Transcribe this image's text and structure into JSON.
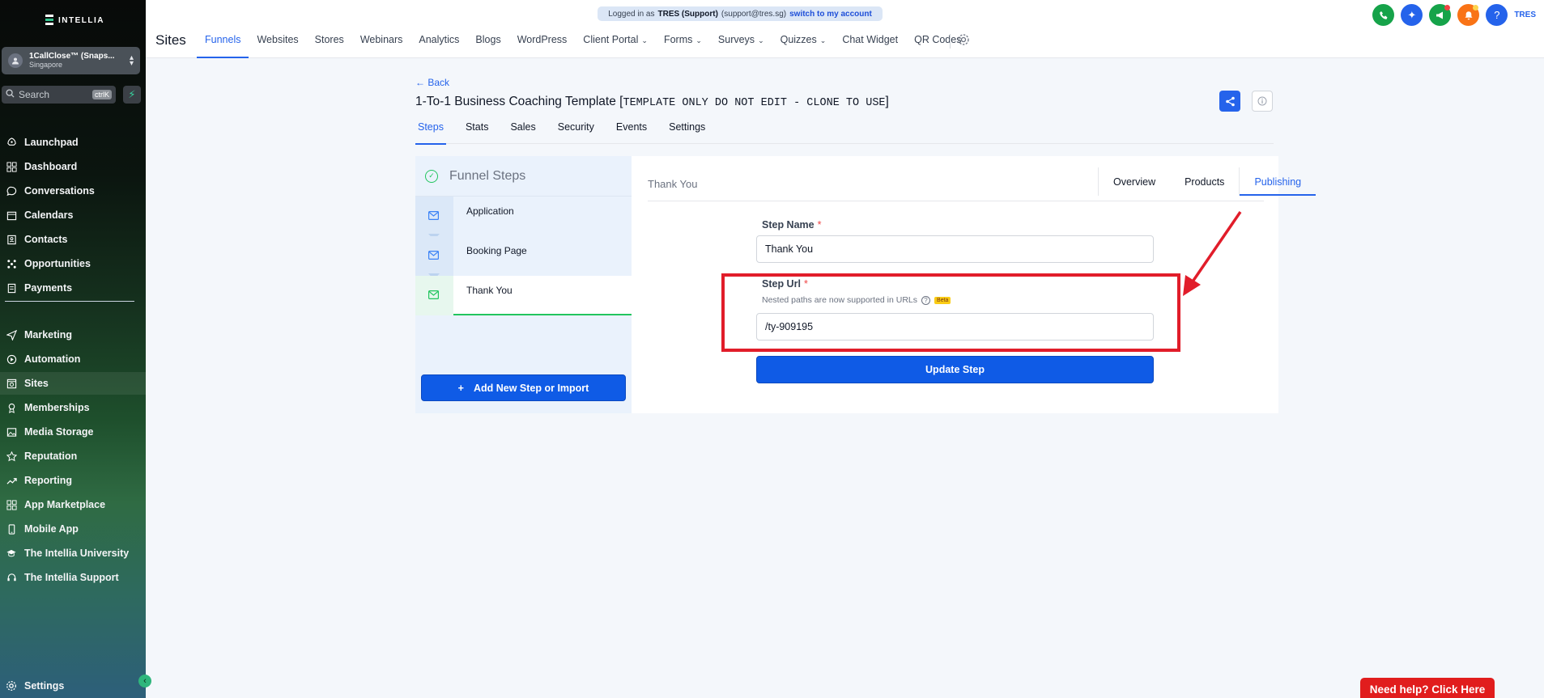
{
  "brand": {
    "name": "INTELLIA"
  },
  "account": {
    "name": "1CallClose™ (Snaps...",
    "location": "Singapore"
  },
  "search": {
    "placeholder": "Search",
    "shortcut": "ctrlK"
  },
  "sidebar": {
    "items": [
      {
        "label": "Launchpad",
        "icon": "rocket-icon"
      },
      {
        "label": "Dashboard",
        "icon": "grid-icon"
      },
      {
        "label": "Conversations",
        "icon": "chat-icon"
      },
      {
        "label": "Calendars",
        "icon": "calendar-icon"
      },
      {
        "label": "Contacts",
        "icon": "contacts-icon"
      },
      {
        "label": "Opportunities",
        "icon": "opportunities-icon"
      },
      {
        "label": "Payments",
        "icon": "payments-icon"
      },
      {
        "label": "Marketing",
        "icon": "send-icon"
      },
      {
        "label": "Automation",
        "icon": "automation-icon"
      },
      {
        "label": "Sites",
        "icon": "sites-icon",
        "active": true
      },
      {
        "label": "Memberships",
        "icon": "memberships-icon"
      },
      {
        "label": "Media Storage",
        "icon": "image-icon"
      },
      {
        "label": "Reputation",
        "icon": "star-icon"
      },
      {
        "label": "Reporting",
        "icon": "trend-icon"
      },
      {
        "label": "App Marketplace",
        "icon": "apps-icon"
      },
      {
        "label": "Mobile App",
        "icon": "mobile-icon"
      },
      {
        "label": "The Intellia University",
        "icon": "graduation-icon"
      },
      {
        "label": "The Intellia Support",
        "icon": "support-icon"
      }
    ],
    "settings_label": "Settings"
  },
  "banner": {
    "prefix": "Logged in as",
    "user": "TRES (Support)",
    "email": "(support@tres.sg)",
    "link": "switch to my account"
  },
  "header": {
    "title": "Sites",
    "tabs": [
      {
        "label": "Funnels",
        "active": true
      },
      {
        "label": "Websites"
      },
      {
        "label": "Stores"
      },
      {
        "label": "Webinars"
      },
      {
        "label": "Analytics"
      },
      {
        "label": "Blogs"
      },
      {
        "label": "WordPress"
      },
      {
        "label": "Client Portal",
        "dropdown": true
      },
      {
        "label": "Forms",
        "dropdown": true
      },
      {
        "label": "Surveys",
        "dropdown": true
      },
      {
        "label": "Quizzes",
        "dropdown": true
      },
      {
        "label": "Chat Widget"
      },
      {
        "label": "QR Codes"
      }
    ],
    "user_initials": "TRES",
    "colors": {
      "phone": "#16a34a",
      "magic": "#2563eb",
      "megaphone": "#16a34a",
      "bell": "#f97316",
      "help": "#2563eb"
    }
  },
  "page": {
    "back_label": "Back",
    "title": "1-To-1 Business Coaching Template [",
    "title_mono": "TEMPLATE ONLY DO NOT EDIT - CLONE TO USE",
    "title_end": "]",
    "subtabs": [
      {
        "label": "Steps",
        "active": true
      },
      {
        "label": "Stats"
      },
      {
        "label": "Sales"
      },
      {
        "label": "Security"
      },
      {
        "label": "Events"
      },
      {
        "label": "Settings"
      }
    ]
  },
  "funnel_steps": {
    "title": "Funnel Steps",
    "steps": [
      {
        "label": "Application"
      },
      {
        "label": "Booking Page"
      },
      {
        "label": "Thank You",
        "active": true
      }
    ],
    "add_label": "Add New Step or Import"
  },
  "detail": {
    "title": "Thank You",
    "tabs": [
      {
        "label": "Overview"
      },
      {
        "label": "Products"
      },
      {
        "label": "Publishing",
        "active": true
      }
    ],
    "step_name_label": "Step Name",
    "step_name_value": "Thank You",
    "step_url_label": "Step Url",
    "step_url_hint": "Nested paths are now supported in URLs",
    "beta_label": "Beta",
    "step_url_value": "/ty-909195",
    "required_mark": "*",
    "update_label": "Update Step"
  },
  "help": {
    "label": "Need help? Click Here"
  }
}
